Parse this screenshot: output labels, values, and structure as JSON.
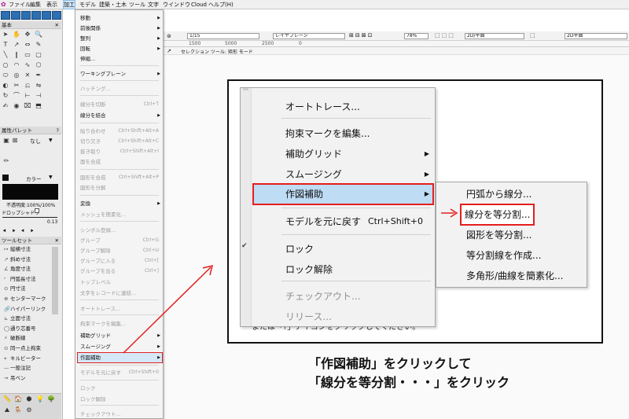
{
  "menubar": {
    "items": [
      "ファイル",
      "編集",
      "表示",
      "加工",
      "モデル",
      "建築・土木",
      "ツール",
      "文字",
      "ウインドウ",
      "Cloud",
      "ヘルプ(H)"
    ]
  },
  "left": {
    "basic_palette_title": "基本",
    "attr_palette_title": "属性パレット",
    "attr_help": "?",
    "attr_fill_value": "なし",
    "attr_color_label": "カラー",
    "attr_opacity": "不透明度:100%/100%",
    "attr_dropshadow": "ドロップシャドウ",
    "attr_line_value": "0.13",
    "toolset_title": "ツールセット",
    "toolset_items": [
      "縦横寸法",
      "斜め寸法",
      "角度寸法",
      "円弧長寸法",
      "円寸法",
      "センターマーク",
      "ハイパーリンク",
      "立面寸法",
      "通り芯番号",
      "破断線",
      "同一点上拘束",
      "キルビーター",
      "一般注記",
      "吊ベン"
    ]
  },
  "toolbar": {
    "layer_scale": "1/15",
    "layer_plane": "レイヤプレーン",
    "zoom": "78%",
    "view": "2D/平面",
    "view2": "2D平面"
  },
  "ruler": {
    "marks": [
      "1500",
      "5000",
      "2500",
      "0"
    ]
  },
  "modebar": {
    "text": "セレクション ツール: 矩形 モード"
  },
  "dropdown": {
    "items": [
      {
        "label": "移動",
        "arrow": true
      },
      {
        "label": "前後関係",
        "arrow": true
      },
      {
        "label": "整列",
        "arrow": true
      },
      {
        "label": "回転",
        "arrow": true
      },
      {
        "label": "伸縮..."
      },
      {
        "label": "ワーキングプレーン",
        "arrow": true
      },
      {
        "label": "ハッチング...",
        "disabled": true
      },
      {
        "label": "線分を切断",
        "shortcut": "Ctrl+T",
        "disabled": true
      },
      {
        "label": "線分を結合",
        "arrow": true
      },
      {
        "label": "貼り合わせ",
        "shortcut": "Ctrl+Shift+Alt+A",
        "disabled": true
      },
      {
        "label": "切り欠き",
        "shortcut": "Ctrl+Shift+Alt+C",
        "disabled": true
      },
      {
        "label": "抜き取り",
        "shortcut": "Ctrl+Shift+Alt+I",
        "disabled": true
      },
      {
        "label": "面を合成",
        "disabled": true
      },
      {
        "label": "図形を合成",
        "shortcut": "Ctrl+Shift+Alt+P",
        "disabled": true
      },
      {
        "label": "図形を分解",
        "disabled": true
      },
      {
        "label": "変換",
        "arrow": true
      },
      {
        "label": "メッシュを簡素化...",
        "disabled": true
      },
      {
        "label": "シンボル登録...",
        "disabled": true
      },
      {
        "label": "グループ",
        "shortcut": "Ctrl+G",
        "disabled": true
      },
      {
        "label": "グループ解除",
        "shortcut": "Ctrl+U",
        "disabled": true
      },
      {
        "label": "グループに入る",
        "shortcut": "Ctrl+[",
        "disabled": true
      },
      {
        "label": "グループを出る",
        "shortcut": "Ctrl+]",
        "disabled": true
      },
      {
        "label": "トップレベル",
        "disabled": true
      },
      {
        "label": "文字をレコードに連結...",
        "disabled": true
      },
      {
        "label": "オートトレース...",
        "disabled": true
      },
      {
        "label": "拘束マークを編集...",
        "disabled": true
      },
      {
        "label": "補助グリッド",
        "arrow": true
      },
      {
        "label": "スムージング",
        "arrow": true
      },
      {
        "label": "作図補助",
        "arrow": true,
        "highlighted": true
      },
      {
        "label": "モデルを元に戻す",
        "shortcut": "Ctrl+Shift+0",
        "disabled": true
      },
      {
        "label": "ロック",
        "disabled": true
      },
      {
        "label": "ロック解除",
        "disabled": true
      },
      {
        "label": "チェックアウト...",
        "disabled": true
      }
    ]
  },
  "zoom_menu": {
    "items": [
      {
        "label": "オートトレース..."
      },
      {
        "label": "拘束マークを編集..."
      },
      {
        "label": "補助グリッド",
        "arrow": true
      },
      {
        "label": "スムージング",
        "arrow": true
      },
      {
        "label": "作図補助",
        "arrow": true,
        "highlighted": true
      },
      {
        "label": "モデルを元に戻す",
        "shortcut": "Ctrl+Shift+0"
      },
      {
        "label": "ロック"
      },
      {
        "label": "ロック解除"
      },
      {
        "label": "チェックアウト...",
        "disabled": true
      },
      {
        "label": "リリース...",
        "disabled": true
      }
    ],
    "background_text": "ーまたは「?」アイコンをクリックしてください。"
  },
  "submenu": {
    "items": [
      {
        "label": "円弧から線分..."
      },
      {
        "label": "線分を等分割...",
        "highlighted": true
      },
      {
        "label": "図形を等分割..."
      },
      {
        "label": "等分割線を作成..."
      },
      {
        "label": "多角形/曲線を簡素化..."
      }
    ]
  },
  "caption": {
    "line1": "「作図補助」をクリックして",
    "line2": "「線分を等分割・・・」をクリック"
  },
  "colors": {
    "annotation": "#e41e1e",
    "highlight": "#bfdcf5"
  }
}
